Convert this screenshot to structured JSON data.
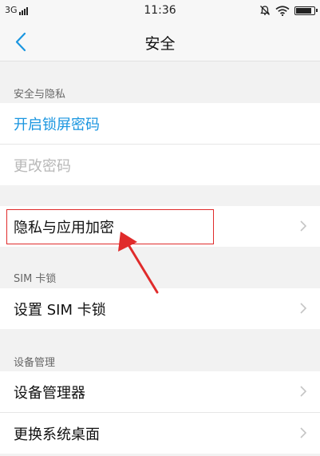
{
  "status_bar": {
    "network": "3G",
    "time": "11:36",
    "icons": [
      "signal-icon",
      "alarm-off-icon",
      "wifi-icon",
      "battery-icon"
    ],
    "battery_level": 0.95
  },
  "nav": {
    "title": "安全",
    "back_icon": "back-chevron-icon"
  },
  "sections": {
    "privacy": {
      "header": "安全与隐私",
      "items": [
        {
          "label": "开启锁屏密码",
          "color": "#1a96e0"
        },
        {
          "label": "更改密码",
          "color": "#b8b8b8"
        }
      ]
    },
    "encryption": {
      "items": [
        {
          "label": "隐私与应用加密"
        }
      ]
    },
    "sim": {
      "header": "SIM 卡锁",
      "items": [
        {
          "label": "设置 SIM 卡锁"
        }
      ]
    },
    "device": {
      "header": "设备管理",
      "items": [
        {
          "label": "设备管理器"
        },
        {
          "label": "更换系统桌面"
        }
      ]
    }
  },
  "colors": {
    "accent": "#1a96e0",
    "disabled": "#b8b8b8",
    "annotation": "#e02b2b"
  }
}
